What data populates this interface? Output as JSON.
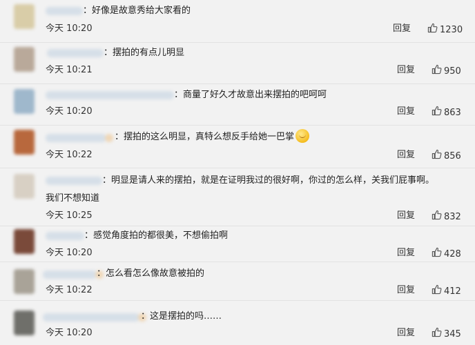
{
  "comments": [
    {
      "text": "好像是故意秀给大家看的",
      "time": "今天 10:20",
      "reply": "回复",
      "likes": "1230",
      "avatar_color": "#d9cda8"
    },
    {
      "text": "摆拍的有点儿明显",
      "time": "今天 10:21",
      "reply": "回复",
      "likes": "950",
      "avatar_color": "#b9a99a"
    },
    {
      "text": "商量了好久才故意出来摆拍的吧呵呵",
      "time": "今天 10:20",
      "reply": "回复",
      "likes": "863",
      "avatar_color": "#9fb8cc"
    },
    {
      "text": "摆拍的这么明显，真特么想反手给她一巴掌",
      "time": "今天 10:22",
      "reply": "回复",
      "likes": "856",
      "avatar_color": "#b8683d"
    },
    {
      "text": "明显是请人来的摆拍，就是在证明我过的很好啊，你过的怎么样，关我们屁事啊。",
      "text2": "我们不想知道",
      "time": "今天 10:25",
      "reply": "回复",
      "likes": "832",
      "avatar_color": "#d8d0c4"
    },
    {
      "text": "感觉角度拍的都很美，不想偷拍啊",
      "time": "今天 10:20",
      "reply": "回复",
      "likes": "428",
      "avatar_color": "#7a4a3a"
    },
    {
      "text": "怎么看怎么像故意被拍的",
      "time": "今天 10:22",
      "reply": "回复",
      "likes": "412",
      "avatar_color": "#a9a398"
    },
    {
      "text": "这是摆拍的吗……",
      "time": "今天 10:20",
      "reply": "回复",
      "likes": "345",
      "avatar_color": "#6f6f6a"
    }
  ]
}
